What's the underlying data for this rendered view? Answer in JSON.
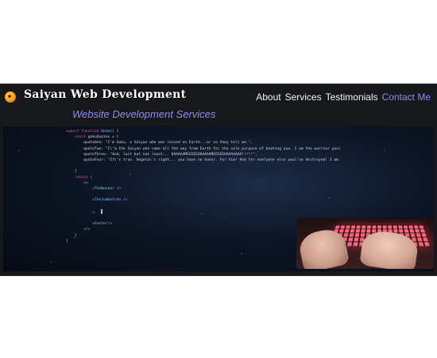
{
  "header": {
    "logo_icon": "dragon-ball-icon",
    "brand": "Saiyan Web Development",
    "nav": [
      {
        "label": "About",
        "active": false
      },
      {
        "label": "Services",
        "active": false
      },
      {
        "label": "Testimonials",
        "active": false
      },
      {
        "label": "Contact Me",
        "active": true
      }
    ],
    "accent_color": "#8c8df2"
  },
  "hero": {
    "subtitle": "Website Development Services",
    "code_lines": [
      "export function Home() {",
      "    const gokuQuotes = {",
      "        quoteOne: \"I'm Goku, a Saiyan who was raised on Earth...or so they tell me.\",",
      "        quoteTwo: \"I\\'m the Saiyan who came all the way from Earth for the sole purpose of beating you. I am the warrior you\\",
      "        quoteThree: \"And, last but not least... KAAAAAMEEEEEHAAAAAMEEEEEHAAAAAAA!!!!!\",",
      "        quoteFour: \"It\\'s true. Vegeta\\'s right... you have no honor. For him! And for everyone else you\\'ve destroyed! I am",
      "",
      "    }",
      "    return (",
      "        <>",
      "            <TheNavbar />",
      "",
      "            <TheJumbotron />",
      "",
      "            <",
      "",
      "            <Footer/>",
      "        </>",
      "    )",
      "}"
    ],
    "image_alt": "hands typing on red backlit keyboard"
  }
}
